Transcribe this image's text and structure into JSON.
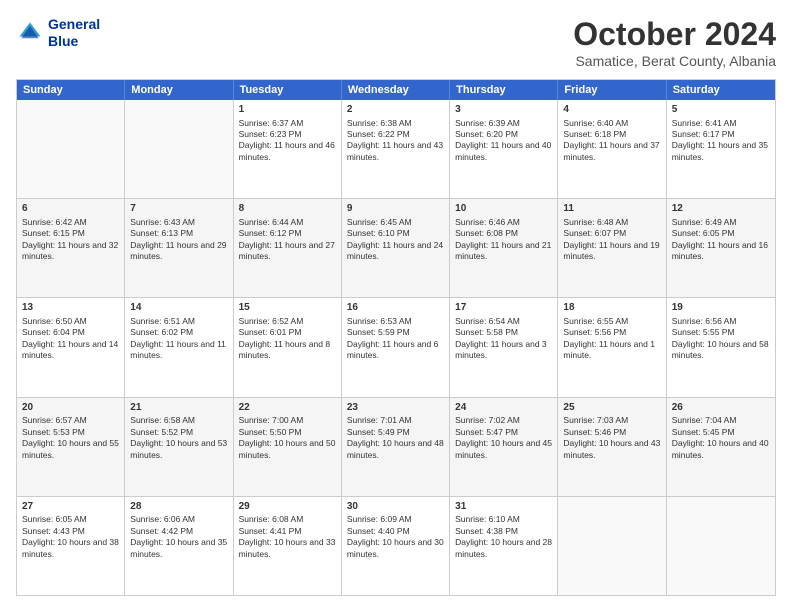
{
  "header": {
    "logo_line1": "General",
    "logo_line2": "Blue",
    "month_title": "October 2024",
    "subtitle": "Samatice, Berat County, Albania"
  },
  "days_of_week": [
    "Sunday",
    "Monday",
    "Tuesday",
    "Wednesday",
    "Thursday",
    "Friday",
    "Saturday"
  ],
  "weeks": [
    [
      {
        "day": "",
        "sunrise": "",
        "sunset": "",
        "daylight": "",
        "empty": true
      },
      {
        "day": "",
        "sunrise": "",
        "sunset": "",
        "daylight": "",
        "empty": true
      },
      {
        "day": "1",
        "sunrise": "Sunrise: 6:37 AM",
        "sunset": "Sunset: 6:23 PM",
        "daylight": "Daylight: 11 hours and 46 minutes."
      },
      {
        "day": "2",
        "sunrise": "Sunrise: 6:38 AM",
        "sunset": "Sunset: 6:22 PM",
        "daylight": "Daylight: 11 hours and 43 minutes."
      },
      {
        "day": "3",
        "sunrise": "Sunrise: 6:39 AM",
        "sunset": "Sunset: 6:20 PM",
        "daylight": "Daylight: 11 hours and 40 minutes."
      },
      {
        "day": "4",
        "sunrise": "Sunrise: 6:40 AM",
        "sunset": "Sunset: 6:18 PM",
        "daylight": "Daylight: 11 hours and 37 minutes."
      },
      {
        "day": "5",
        "sunrise": "Sunrise: 6:41 AM",
        "sunset": "Sunset: 6:17 PM",
        "daylight": "Daylight: 11 hours and 35 minutes."
      }
    ],
    [
      {
        "day": "6",
        "sunrise": "Sunrise: 6:42 AM",
        "sunset": "Sunset: 6:15 PM",
        "daylight": "Daylight: 11 hours and 32 minutes."
      },
      {
        "day": "7",
        "sunrise": "Sunrise: 6:43 AM",
        "sunset": "Sunset: 6:13 PM",
        "daylight": "Daylight: 11 hours and 29 minutes."
      },
      {
        "day": "8",
        "sunrise": "Sunrise: 6:44 AM",
        "sunset": "Sunset: 6:12 PM",
        "daylight": "Daylight: 11 hours and 27 minutes."
      },
      {
        "day": "9",
        "sunrise": "Sunrise: 6:45 AM",
        "sunset": "Sunset: 6:10 PM",
        "daylight": "Daylight: 11 hours and 24 minutes."
      },
      {
        "day": "10",
        "sunrise": "Sunrise: 6:46 AM",
        "sunset": "Sunset: 6:08 PM",
        "daylight": "Daylight: 11 hours and 21 minutes."
      },
      {
        "day": "11",
        "sunrise": "Sunrise: 6:48 AM",
        "sunset": "Sunset: 6:07 PM",
        "daylight": "Daylight: 11 hours and 19 minutes."
      },
      {
        "day": "12",
        "sunrise": "Sunrise: 6:49 AM",
        "sunset": "Sunset: 6:05 PM",
        "daylight": "Daylight: 11 hours and 16 minutes."
      }
    ],
    [
      {
        "day": "13",
        "sunrise": "Sunrise: 6:50 AM",
        "sunset": "Sunset: 6:04 PM",
        "daylight": "Daylight: 11 hours and 14 minutes."
      },
      {
        "day": "14",
        "sunrise": "Sunrise: 6:51 AM",
        "sunset": "Sunset: 6:02 PM",
        "daylight": "Daylight: 11 hours and 11 minutes."
      },
      {
        "day": "15",
        "sunrise": "Sunrise: 6:52 AM",
        "sunset": "Sunset: 6:01 PM",
        "daylight": "Daylight: 11 hours and 8 minutes."
      },
      {
        "day": "16",
        "sunrise": "Sunrise: 6:53 AM",
        "sunset": "Sunset: 5:59 PM",
        "daylight": "Daylight: 11 hours and 6 minutes."
      },
      {
        "day": "17",
        "sunrise": "Sunrise: 6:54 AM",
        "sunset": "Sunset: 5:58 PM",
        "daylight": "Daylight: 11 hours and 3 minutes."
      },
      {
        "day": "18",
        "sunrise": "Sunrise: 6:55 AM",
        "sunset": "Sunset: 5:56 PM",
        "daylight": "Daylight: 11 hours and 1 minute."
      },
      {
        "day": "19",
        "sunrise": "Sunrise: 6:56 AM",
        "sunset": "Sunset: 5:55 PM",
        "daylight": "Daylight: 10 hours and 58 minutes."
      }
    ],
    [
      {
        "day": "20",
        "sunrise": "Sunrise: 6:57 AM",
        "sunset": "Sunset: 5:53 PM",
        "daylight": "Daylight: 10 hours and 55 minutes."
      },
      {
        "day": "21",
        "sunrise": "Sunrise: 6:58 AM",
        "sunset": "Sunset: 5:52 PM",
        "daylight": "Daylight: 10 hours and 53 minutes."
      },
      {
        "day": "22",
        "sunrise": "Sunrise: 7:00 AM",
        "sunset": "Sunset: 5:50 PM",
        "daylight": "Daylight: 10 hours and 50 minutes."
      },
      {
        "day": "23",
        "sunrise": "Sunrise: 7:01 AM",
        "sunset": "Sunset: 5:49 PM",
        "daylight": "Daylight: 10 hours and 48 minutes."
      },
      {
        "day": "24",
        "sunrise": "Sunrise: 7:02 AM",
        "sunset": "Sunset: 5:47 PM",
        "daylight": "Daylight: 10 hours and 45 minutes."
      },
      {
        "day": "25",
        "sunrise": "Sunrise: 7:03 AM",
        "sunset": "Sunset: 5:46 PM",
        "daylight": "Daylight: 10 hours and 43 minutes."
      },
      {
        "day": "26",
        "sunrise": "Sunrise: 7:04 AM",
        "sunset": "Sunset: 5:45 PM",
        "daylight": "Daylight: 10 hours and 40 minutes."
      }
    ],
    [
      {
        "day": "27",
        "sunrise": "Sunrise: 6:05 AM",
        "sunset": "Sunset: 4:43 PM",
        "daylight": "Daylight: 10 hours and 38 minutes."
      },
      {
        "day": "28",
        "sunrise": "Sunrise: 6:06 AM",
        "sunset": "Sunset: 4:42 PM",
        "daylight": "Daylight: 10 hours and 35 minutes."
      },
      {
        "day": "29",
        "sunrise": "Sunrise: 6:08 AM",
        "sunset": "Sunset: 4:41 PM",
        "daylight": "Daylight: 10 hours and 33 minutes."
      },
      {
        "day": "30",
        "sunrise": "Sunrise: 6:09 AM",
        "sunset": "Sunset: 4:40 PM",
        "daylight": "Daylight: 10 hours and 30 minutes."
      },
      {
        "day": "31",
        "sunrise": "Sunrise: 6:10 AM",
        "sunset": "Sunset: 4:38 PM",
        "daylight": "Daylight: 10 hours and 28 minutes."
      },
      {
        "day": "",
        "sunrise": "",
        "sunset": "",
        "daylight": "",
        "empty": true
      },
      {
        "day": "",
        "sunrise": "",
        "sunset": "",
        "daylight": "",
        "empty": true
      }
    ]
  ]
}
